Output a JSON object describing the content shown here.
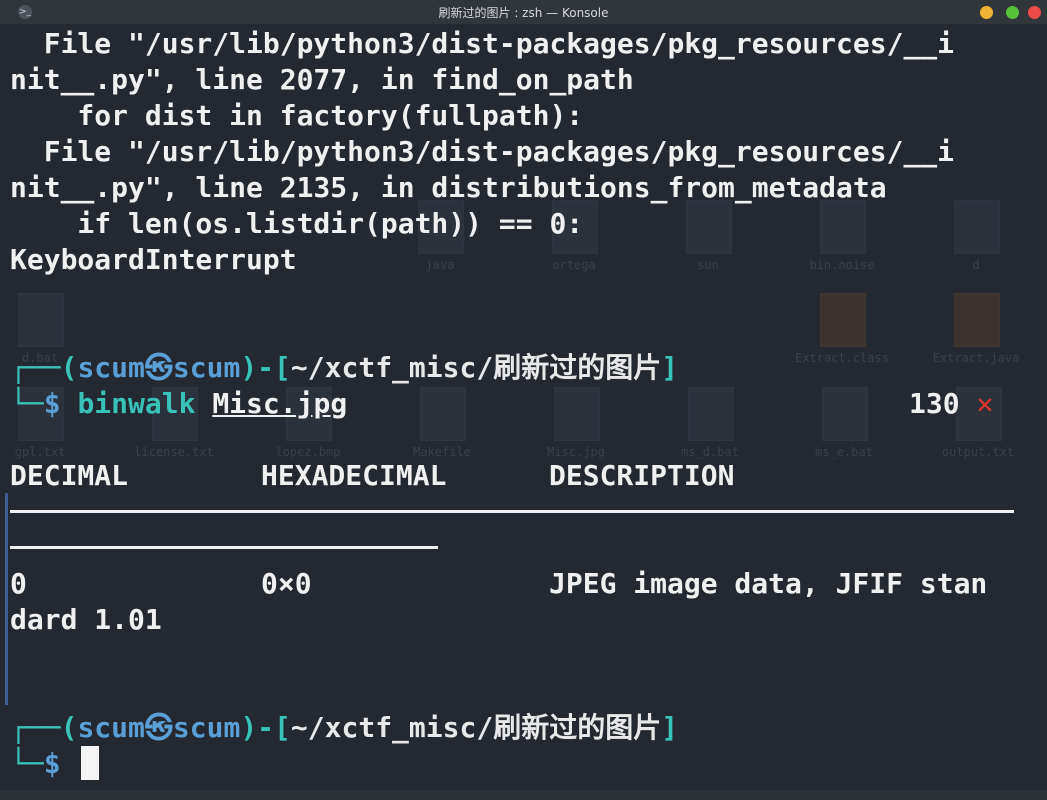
{
  "window": {
    "title": "刷新过的图片 : zsh — Konsole",
    "app_icon": ">_",
    "buttons": {
      "minimize": "minimize",
      "maximize": "maximize",
      "close": "close"
    }
  },
  "terminal": {
    "traceback": [
      "  File \"/usr/lib/python3/dist-packages/pkg_resources/__i",
      "nit__.py\", line 2077, in find_on_path",
      "    for dist in factory(fullpath):",
      "  File \"/usr/lib/python3/dist-packages/pkg_resources/__i",
      "nit__.py\", line 2135, in distributions_from_metadata",
      "    if len(os.listdir(path)) == 0:",
      "KeyboardInterrupt"
    ],
    "prompt1": {
      "user": "scum",
      "at": "㉿",
      "host": "scum",
      "path": "~/xctf_misc/刷新过的图片",
      "command": "binwalk",
      "arg": "Misc.jpg",
      "exit_code": "130",
      "error_mark": "✕"
    },
    "binwalk_headers": [
      "DECIMAL",
      "HEXADECIMAL",
      "DESCRIPTION"
    ],
    "binwalk_row": {
      "decimal": "0",
      "hex": "0×0",
      "description_line1": "JPEG image data, JFIF stan",
      "description_line2": "dard 1.01"
    },
    "prompt2": {
      "user": "scum",
      "at": "㉿",
      "host": "scum",
      "path": "~/xctf_misc/刷新过的图片"
    }
  },
  "background_files": [
    "java",
    "ortega",
    "sun",
    "bin.noise",
    "d",
    "d.bat",
    "Extract.class",
    "Extract.java",
    "gpl.txt",
    "license.txt",
    "lopez.bmp",
    "Makefile",
    "Misc.jpg",
    "ms_d.bat",
    "ms_e.bat",
    "output.txt"
  ],
  "colors": {
    "terminal_bg": "#232831",
    "prompt_blue": "#5a9fd6",
    "prompt_teal": "#39c2b7",
    "error_red": "#e0342c",
    "text": "#f0f0f0"
  }
}
